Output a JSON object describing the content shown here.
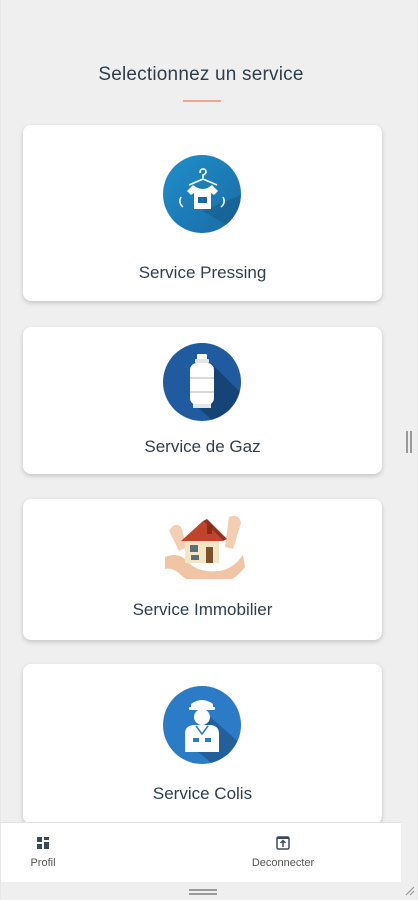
{
  "page": {
    "title": "Selectionnez un service"
  },
  "services": [
    {
      "label": "Service Pressing",
      "icon": "laundry-icon"
    },
    {
      "label": "Service de Gaz",
      "icon": "gas-cylinder-icon"
    },
    {
      "label": "Service Immobilier",
      "icon": "house-in-hands-icon"
    },
    {
      "label": "Service Colis",
      "icon": "delivery-man-icon"
    }
  ],
  "nav": {
    "profil_label": "Profil",
    "logout_label": "Deconnecter"
  },
  "colors": {
    "accent_underline": "#f4a58f",
    "pressing_blue": "#1f8fc9",
    "gaz_blue": "#1f5b9e",
    "colis_blue": "#2c7bc6"
  }
}
